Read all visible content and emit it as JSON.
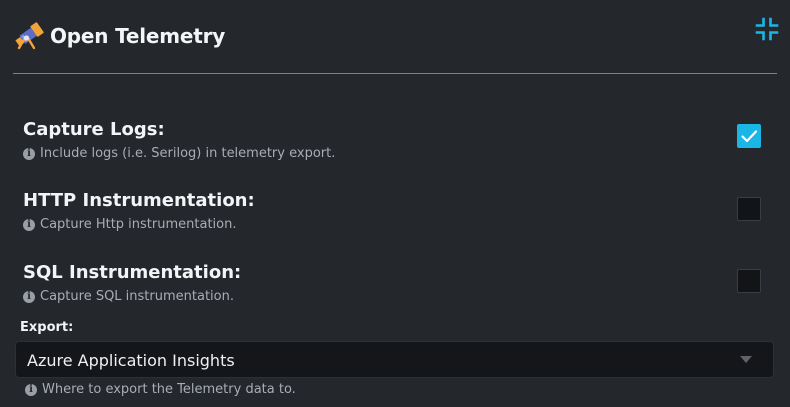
{
  "header": {
    "title": "Open Telemetry",
    "app_icon": "telescope-icon",
    "collapse_icon": "collapse-arrows-icon"
  },
  "settings": [
    {
      "label": "Capture Logs:",
      "help": "Include logs (i.e. Serilog) in telemetry export.",
      "checked": true
    },
    {
      "label": "HTTP Instrumentation:",
      "help": "Capture Http instrumentation.",
      "checked": false
    },
    {
      "label": "SQL Instrumentation:",
      "help": "Capture SQL instrumentation.",
      "checked": false
    }
  ],
  "export": {
    "label": "Export:",
    "selected": "Azure Application Insights",
    "help": "Where to export the Telemetry data to."
  },
  "colors": {
    "background": "#24272c",
    "accent": "#1ab7e6",
    "divider": "#7d8188",
    "help_text": "#a9adb4"
  }
}
